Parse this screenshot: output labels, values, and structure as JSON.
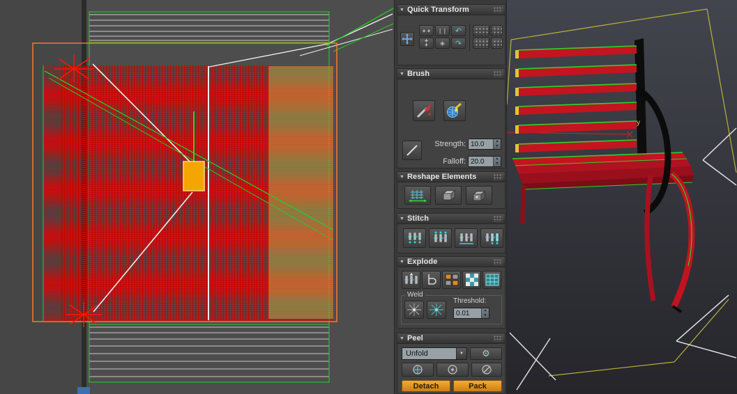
{
  "toolbar": {
    "quick_transform": {
      "title": "Quick Transform"
    },
    "brush": {
      "title": "Brush",
      "strength_label": "Strength:",
      "strength_value": "10.0",
      "falloff_label": "Falloff:",
      "falloff_value": "20.0"
    },
    "reshape_elements": {
      "title": "Reshape Elements"
    },
    "stitch": {
      "title": "Stitch"
    },
    "explode": {
      "title": "Explode",
      "weld_group_label": "Weld",
      "threshold_label": "Threshold:",
      "threshold_value": "0.01"
    },
    "peel": {
      "title": "Peel",
      "mode_value": "Unfold",
      "detach_label": "Detach",
      "pack_label": "Pack"
    }
  },
  "icons": {
    "collapse_arrow": "▼",
    "dropdown_arrow": "▼",
    "gear": "⚙",
    "spinner_up": "▲",
    "spinner_down": "▼",
    "rotate_ccw": "↶",
    "rotate_cw": "↷",
    "diamond": "◈",
    "move_h": "+ +",
    "move_v": "+\n+",
    "align_bars": "❘❘❘❘"
  },
  "viewport": {
    "axis_label": "y"
  },
  "colors": {
    "uv_red": "#e30000",
    "uv_green": "#26cc26",
    "selection_orange": "#ff7f28",
    "pivot_amber": "#f4a500",
    "accent_orange": "#e09225"
  }
}
